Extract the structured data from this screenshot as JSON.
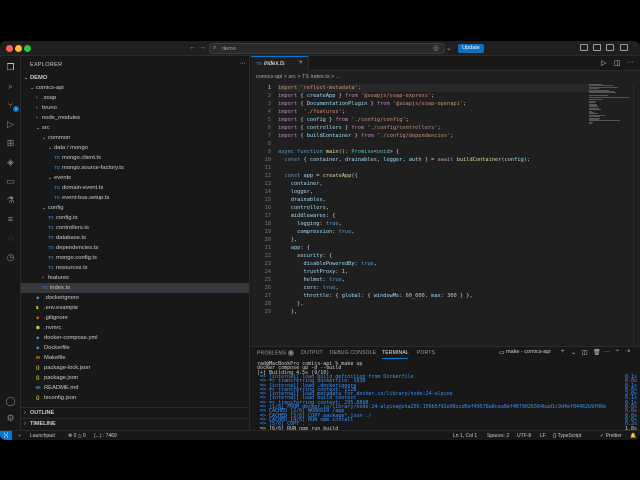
{
  "titlebar": {
    "search_text": "demo",
    "update_label": "Update"
  },
  "activity": {
    "source_control_badge": "1"
  },
  "explorer": {
    "title": "EXPLORER",
    "root": "DEMO",
    "items": [
      {
        "label": "comics-api",
        "kind": "folder-open",
        "depth": 1
      },
      {
        "label": ".soap",
        "kind": "folder",
        "depth": 2
      },
      {
        "label": "bruno",
        "kind": "folder",
        "depth": 2
      },
      {
        "label": "node_modules",
        "kind": "folder",
        "depth": 2
      },
      {
        "label": "src",
        "kind": "folder-open",
        "depth": 2
      },
      {
        "label": "common",
        "kind": "folder-open",
        "depth": 3
      },
      {
        "label": "data / mongo",
        "kind": "folder-open",
        "depth": 4
      },
      {
        "label": "mongo.client.ts",
        "kind": "ts",
        "depth": 5
      },
      {
        "label": "mongo.source-factory.ts",
        "kind": "ts",
        "depth": 5
      },
      {
        "label": "events",
        "kind": "folder-open",
        "depth": 4
      },
      {
        "label": "domain-event.ts",
        "kind": "ts",
        "depth": 5
      },
      {
        "label": "event-bus.setup.ts",
        "kind": "ts",
        "depth": 5
      },
      {
        "label": "config",
        "kind": "folder-open",
        "depth": 3
      },
      {
        "label": "config.ts",
        "kind": "ts",
        "depth": 4
      },
      {
        "label": "controllers.ts",
        "kind": "ts",
        "depth": 4
      },
      {
        "label": "database.ts",
        "kind": "ts",
        "depth": 4
      },
      {
        "label": "dependencies.ts",
        "kind": "ts",
        "depth": 4
      },
      {
        "label": "mongo.config.ts",
        "kind": "ts",
        "depth": 4
      },
      {
        "label": "resources.ts",
        "kind": "ts",
        "depth": 4
      },
      {
        "label": "features",
        "kind": "folder",
        "depth": 3
      },
      {
        "label": "index.ts",
        "kind": "ts",
        "depth": 3,
        "selected": true
      },
      {
        "label": ".dockerignore",
        "kind": "docker",
        "depth": 2
      },
      {
        "label": ".env.example",
        "kind": "env",
        "depth": 2
      },
      {
        "label": ".gitignore",
        "kind": "git",
        "depth": 2
      },
      {
        "label": ".nvmrc",
        "kind": "nvm",
        "depth": 2
      },
      {
        "label": "docker-compose.yml",
        "kind": "docker",
        "depth": 2
      },
      {
        "label": "Dockerfile",
        "kind": "docker",
        "depth": 2
      },
      {
        "label": "Makefile",
        "kind": "make",
        "depth": 2
      },
      {
        "label": "package-lock.json",
        "kind": "json",
        "depth": 2
      },
      {
        "label": "package.json",
        "kind": "json",
        "depth": 2
      },
      {
        "label": "README.md",
        "kind": "md",
        "depth": 2
      },
      {
        "label": "tsconfig.json",
        "kind": "json",
        "depth": 2
      }
    ],
    "outline": "OUTLINE",
    "timeline": "TIMELINE"
  },
  "editor": {
    "tab_label": "index.ts",
    "breadcrumbs": "comics-api  >  src  >  TS index.ts  >  ...",
    "lines": [
      {
        "n": "1",
        "t": [
          [
            "str",
            "import 'reflect-metadata';"
          ]
        ]
      },
      {
        "n": "2",
        "t": [
          [
            "kw",
            "import"
          ],
          [
            "",
            "{ "
          ],
          [
            "vr",
            "createApp"
          ],
          [
            "",
            " } "
          ],
          [
            "kw",
            "from"
          ],
          [
            "",
            ""
          ],
          [
            "str",
            " '@soapjs/soap-express'"
          ],
          [
            "",
            ";"
          ]
        ]
      },
      {
        "n": "3",
        "t": [
          [
            "kw",
            "import"
          ],
          [
            "",
            "{ "
          ],
          [
            "vr",
            "DocumentationPlugin"
          ],
          [
            "",
            " } "
          ],
          [
            "kw",
            "from"
          ],
          [
            "str",
            " '@soapjs/soap-openapi'"
          ],
          [
            "",
            ";"
          ]
        ]
      },
      {
        "n": "4",
        "t": [
          [
            "kw",
            "import"
          ],
          [
            "str",
            " './features'"
          ],
          [
            "",
            ";"
          ]
        ]
      },
      {
        "n": "5",
        "t": [
          [
            "kw",
            "import"
          ],
          [
            "",
            "{ "
          ],
          [
            "vr",
            "config"
          ],
          [
            "",
            " } "
          ],
          [
            "kw",
            "from"
          ],
          [
            "str",
            " './config/config'"
          ],
          [
            "",
            ";"
          ]
        ]
      },
      {
        "n": "6",
        "t": [
          [
            "kw",
            "import"
          ],
          [
            "",
            "{ "
          ],
          [
            "vr",
            "controllers"
          ],
          [
            "",
            " } "
          ],
          [
            "kw",
            "from"
          ],
          [
            "str",
            " './config/controllers'"
          ],
          [
            "",
            ";"
          ]
        ]
      },
      {
        "n": "7",
        "t": [
          [
            "kw",
            "import"
          ],
          [
            "",
            "{ "
          ],
          [
            "vr",
            "buildContainer"
          ],
          [
            "",
            " } "
          ],
          [
            "kw",
            "from"
          ],
          [
            "str",
            " './config/dependencies'"
          ],
          [
            "",
            ";"
          ]
        ]
      },
      {
        "n": "8",
        "t": [
          [
            "",
            ""
          ]
        ]
      },
      {
        "n": "9",
        "t": [
          [
            "kw2",
            "async function "
          ],
          [
            "fn",
            "main"
          ],
          [
            "",
            "(): "
          ],
          [
            "ty",
            "Promise"
          ],
          [
            "",
            "<"
          ],
          [
            "ty",
            "void"
          ],
          [
            "",
            "> {"
          ]
        ]
      },
      {
        "n": "10",
        "t": [
          [
            "",
            "  "
          ],
          [
            "kw2",
            "const"
          ],
          [
            "",
            " { "
          ],
          [
            "vr",
            "container"
          ],
          [
            ", "
          ],
          [
            "vr",
            "drainables"
          ],
          [
            ", "
          ],
          [
            "vr",
            "logger"
          ],
          [
            ", "
          ],
          [
            "vr",
            "auth"
          ],
          [
            "",
            " } = "
          ],
          [
            "kw",
            "await "
          ],
          [
            "fn",
            "buildContainer"
          ],
          [
            "",
            "("
          ],
          [
            "vr",
            "config"
          ],
          [
            "",
            ");"
          ]
        ]
      },
      {
        "n": "11",
        "t": [
          [
            "",
            ""
          ]
        ]
      },
      {
        "n": "12",
        "t": [
          [
            "",
            "  "
          ],
          [
            "kw2",
            "const "
          ],
          [
            "vr",
            "app"
          ],
          [
            "",
            " = "
          ],
          [
            "fn",
            "createApp"
          ],
          [
            "",
            "({"
          ]
        ]
      },
      {
        "n": "13",
        "t": [
          [
            "",
            "    "
          ],
          [
            "vr",
            "container"
          ],
          [
            "",
            ","
          ]
        ]
      },
      {
        "n": "14",
        "t": [
          [
            "",
            "    "
          ],
          [
            "vr",
            "logger"
          ],
          [
            "",
            ","
          ]
        ]
      },
      {
        "n": "15",
        "t": [
          [
            "",
            "    "
          ],
          [
            "vr",
            "drainables"
          ],
          [
            "",
            ","
          ]
        ]
      },
      {
        "n": "16",
        "t": [
          [
            "",
            "    "
          ],
          [
            "vr",
            "controllers"
          ],
          [
            "",
            ","
          ]
        ]
      },
      {
        "n": "17",
        "t": [
          [
            "",
            "    "
          ],
          [
            "vr",
            "middlewares"
          ],
          [
            "",
            ": {"
          ]
        ]
      },
      {
        "n": "18",
        "t": [
          [
            "",
            "      "
          ],
          [
            "vr",
            "logging"
          ],
          [
            "",
            ": "
          ],
          [
            "kw2",
            "true"
          ],
          [
            "",
            ","
          ]
        ]
      },
      {
        "n": "19",
        "t": [
          [
            "",
            "      "
          ],
          [
            "vr",
            "compression"
          ],
          [
            "",
            ": "
          ],
          [
            "kw2",
            "true"
          ],
          [
            "",
            ","
          ]
        ]
      },
      {
        "n": "20",
        "t": [
          [
            "",
            "    },"
          ]
        ]
      },
      {
        "n": "21",
        "t": [
          [
            "",
            "    "
          ],
          [
            "vr",
            "app"
          ],
          [
            "",
            ": {"
          ]
        ]
      },
      {
        "n": "22",
        "t": [
          [
            "",
            "      "
          ],
          [
            "vr",
            "security"
          ],
          [
            "",
            ": {"
          ]
        ]
      },
      {
        "n": "23",
        "t": [
          [
            "",
            "        "
          ],
          [
            "vr",
            "disablePoweredBy"
          ],
          [
            "",
            ": "
          ],
          [
            "kw2",
            "true"
          ],
          [
            "",
            ","
          ]
        ]
      },
      {
        "n": "24",
        "t": [
          [
            "",
            "        "
          ],
          [
            "vr",
            "trustProxy"
          ],
          [
            "",
            ": "
          ],
          [
            "num",
            "1"
          ],
          [
            "",
            ","
          ]
        ]
      },
      {
        "n": "25",
        "t": [
          [
            "",
            "        "
          ],
          [
            "vr",
            "helmet"
          ],
          [
            "",
            ": "
          ],
          [
            "kw2",
            "true"
          ],
          [
            "",
            ","
          ]
        ]
      },
      {
        "n": "26",
        "t": [
          [
            "",
            "        "
          ],
          [
            "vr",
            "cors"
          ],
          [
            "",
            ": "
          ],
          [
            "kw2",
            "true"
          ],
          [
            "",
            ","
          ]
        ]
      },
      {
        "n": "27",
        "t": [
          [
            "",
            "        "
          ],
          [
            "vr",
            "throttle"
          ],
          [
            "",
            ": { "
          ],
          [
            "vr",
            "global"
          ],
          [
            "",
            ": { "
          ],
          [
            "vr",
            "windowMs"
          ],
          [
            "",
            ": "
          ],
          [
            "num",
            "60_000"
          ],
          [
            "",
            ", "
          ],
          [
            "vr",
            "max"
          ],
          [
            "",
            ": "
          ],
          [
            "num",
            "300"
          ],
          [
            "",
            " } },"
          ]
        ]
      },
      {
        "n": "28",
        "t": [
          [
            "",
            "      },"
          ]
        ]
      },
      {
        "n": "29",
        "t": [
          [
            "",
            "    },"
          ]
        ]
      }
    ]
  },
  "panel": {
    "tabs": [
      "PROBLEMS",
      "OUTPUT",
      "DEBUG CONSOLE",
      "TERMINAL",
      "PORTS"
    ],
    "problems_badge": "1",
    "session_label": "make - comics-api",
    "terminal_lines": [
      {
        "text": "rad@MacBookPro comics-api % make up",
        "time": "",
        "blue": false
      },
      {
        "text": "docker compose up -d --build",
        "time": "",
        "blue": false
      },
      {
        "text": "[+] Building 4.5s (9/10)",
        "time": "",
        "blue": false
      },
      {
        "text": " => [internal] load build definition from Dockerfile",
        "time": "0.1s",
        "blue": true
      },
      {
        "text": " => => transferring dockerfile: 193B",
        "time": "0.0s",
        "blue": true
      },
      {
        "text": " => [internal] load .dockerignore",
        "time": "0.1s",
        "blue": true
      },
      {
        "text": " => => transferring context: 112B",
        "time": "0.0s",
        "blue": true
      },
      {
        "text": " => [internal] load metadata for docker.io/library/node:24-alpine",
        "time": "2.0s",
        "blue": true
      },
      {
        "text": " => [internal] load build context",
        "time": "0.1s",
        "blue": true
      },
      {
        "text": " => => transferring context: 295.88kB",
        "time": "0.1s",
        "blue": true
      },
      {
        "text": " => [1/6] FROM docker.io/library/node:24-alpine@sha256:156b5f92e98ccd5ef49578a8cea8ef4679026564bad1c9d4ef84462b9f00e",
        "time": "0.0s",
        "blue": true
      },
      {
        "text": " => CACHED [2/6] WORKDIR /app",
        "time": "0.0s",
        "blue": true
      },
      {
        "text": " => CACHED [3/6] COPY package*.json ./",
        "time": "0.0s",
        "blue": true
      },
      {
        "text": " => CACHED [4/6] RUN npm install",
        "time": "0.0s",
        "blue": true
      },
      {
        "text": " => [5/6] COPY . .",
        "time": "0.2s",
        "blue": true
      },
      {
        "text": " => [6/6] RUN npm run build",
        "time": "1.8s",
        "blue": false
      }
    ]
  },
  "statusbar": {
    "launchpad": "Launchpad",
    "problems": "⊗ 0 △ 0",
    "other": "(...) : 7469",
    "position": "Ln 1, Col 1",
    "spaces": "Spaces: 2",
    "encoding": "UTF-8",
    "eol": "LF",
    "language": "{} TypeScript",
    "prettier": "✓ Prettier"
  }
}
